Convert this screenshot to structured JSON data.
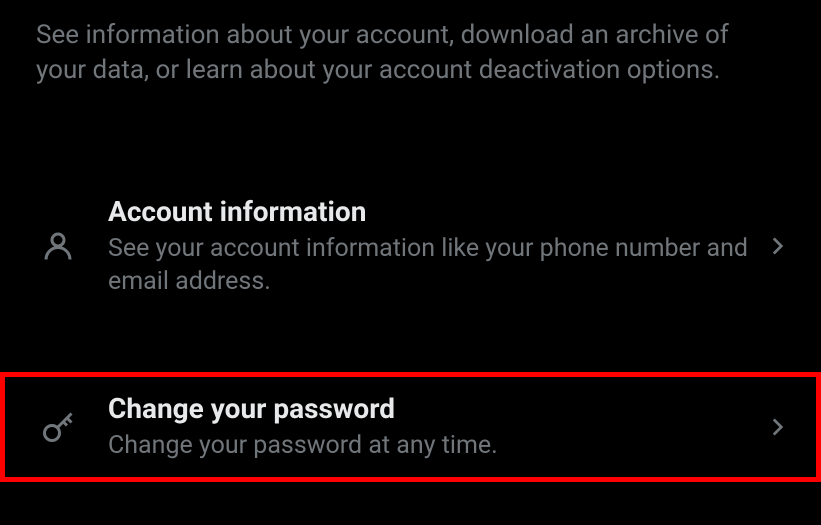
{
  "header": {
    "description": "See information about your account, download an archive of your data, or learn about your account deactivation options."
  },
  "items": [
    {
      "icon": "person-icon",
      "title": "Account information",
      "subtitle": "See your account information like your phone number and email address.",
      "highlighted": false
    },
    {
      "icon": "key-icon",
      "title": "Change your password",
      "subtitle": "Change your password at any time.",
      "highlighted": true
    }
  ]
}
